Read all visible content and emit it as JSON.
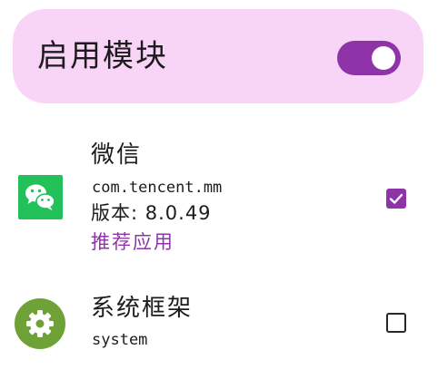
{
  "module": {
    "title": "启用模块",
    "enabled": true
  },
  "apps": [
    {
      "name": "微信",
      "package": "com.tencent.mm",
      "version": "版本: 8.0.49",
      "tag": "推荐应用",
      "icon": "wechat-icon",
      "checked": true
    },
    {
      "name": "系统框架",
      "package": "system",
      "icon": "settings-gear-icon",
      "checked": false
    }
  ],
  "colors": {
    "accent": "#8e34a8",
    "card_background": "#f8d4f6",
    "wechat_green": "#22c15a",
    "system_green": "#6fa236"
  }
}
